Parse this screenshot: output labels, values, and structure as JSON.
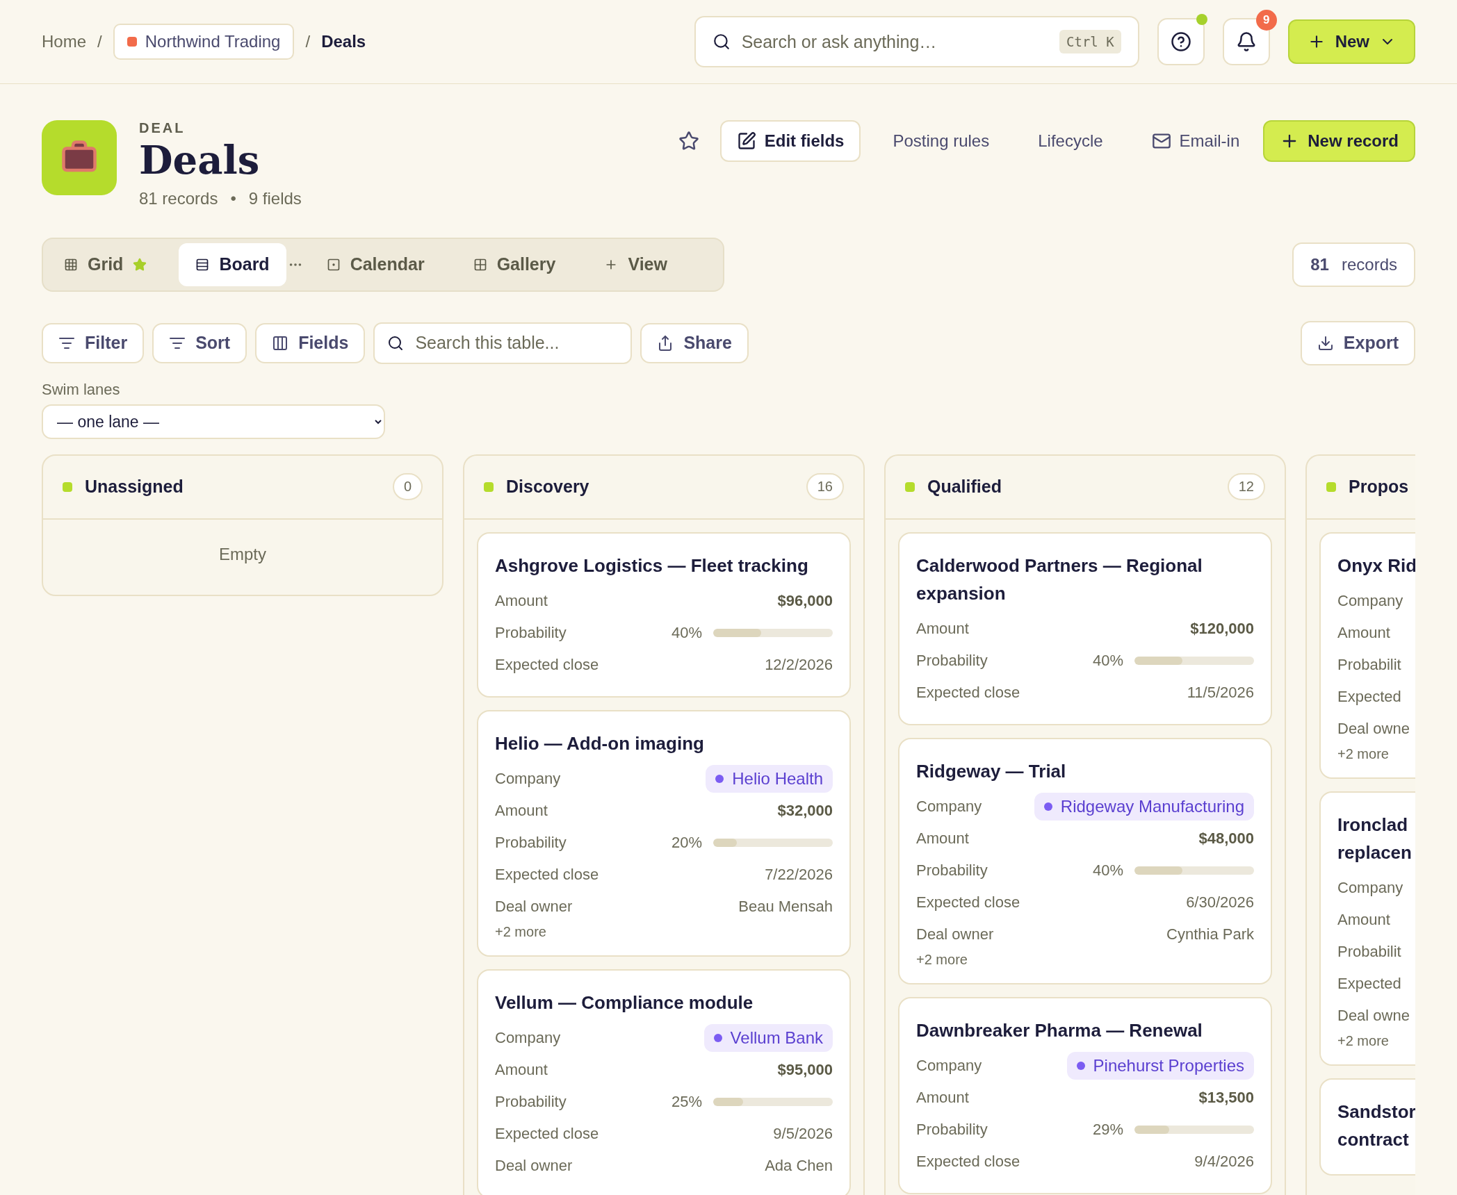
{
  "breadcrumb": {
    "home": "Home",
    "separator": "/",
    "workspace": {
      "label": "Northwind Trading",
      "color": "#f26b4a"
    },
    "separator_2": "/",
    "current": "Deals"
  },
  "search": {
    "placeholder": "Search or ask anything…",
    "shortcut": "Ctrl K"
  },
  "help": {
    "online": true
  },
  "notifications": {
    "count": "9"
  },
  "new_button": {
    "label": "New"
  },
  "header": {
    "eyebrow": "DEAL",
    "title": "Deals",
    "records": "81 records",
    "bullet": "•",
    "fields": "9 fields",
    "starred": false
  },
  "actions": [
    {
      "kind": "outlined",
      "label": "Edit fields"
    },
    {
      "kind": "plain",
      "label": "Posting rules"
    },
    {
      "kind": "plain",
      "label": "Lifecycle"
    },
    {
      "kind": "plain",
      "label": "Email-in"
    },
    {
      "kind": "primary",
      "label": "New record"
    }
  ],
  "views": [
    {
      "label": "Grid",
      "selected": false,
      "favorite": true
    },
    {
      "label": "Board",
      "selected": true,
      "favorite": false,
      "menu": true
    },
    {
      "label": "Calendar",
      "selected": false,
      "favorite": false
    },
    {
      "label": "Gallery",
      "selected": false,
      "favorite": false
    },
    {
      "label": "View",
      "selected": false,
      "favorite": false
    }
  ],
  "record_count": {
    "number": "81",
    "label": "records"
  },
  "toolbar": [
    {
      "label": "Filter"
    },
    {
      "label": "Sort"
    },
    {
      "label": "Fields"
    }
  ],
  "table_search": {
    "placeholder": "Search this table..."
  },
  "share": {
    "label": "Share"
  },
  "export": {
    "label": "Export"
  },
  "swim_lanes": {
    "label": "Swim lanes",
    "value": "— one lane —"
  },
  "columns": [
    {
      "name": "Unassigned",
      "count": "0",
      "empty": "Empty"
    },
    {
      "name": "Discovery",
      "count": "16",
      "cards": [
        {
          "title": "Ashgrove Logistics — Fleet tracking",
          "fields": [
            {
              "kind": "amount",
              "label": "Amount",
              "value": "$96,000"
            },
            {
              "kind": "probability",
              "label": "Probability",
              "value": "40%",
              "level": 0.4
            },
            {
              "kind": "text",
              "label": "Expected close",
              "value": "12/2/2026"
            }
          ]
        },
        {
          "title": "Helio — Add-on imaging",
          "fields": [
            {
              "kind": "company",
              "label": "Company",
              "value": "Helio Health"
            },
            {
              "kind": "amount",
              "label": "Amount",
              "value": "$32,000"
            },
            {
              "kind": "probability",
              "label": "Probability",
              "value": "20%",
              "level": 0.2
            },
            {
              "kind": "text",
              "label": "Expected close",
              "value": "7/22/2026"
            },
            {
              "kind": "text",
              "label": "Deal owner",
              "value": "Beau Mensah"
            }
          ],
          "more": "+2 more"
        },
        {
          "title": "Vellum — Compliance module",
          "fields": [
            {
              "kind": "company",
              "label": "Company",
              "value": "Vellum Bank"
            },
            {
              "kind": "amount",
              "label": "Amount",
              "value": "$95,000"
            },
            {
              "kind": "probability",
              "label": "Probability",
              "value": "25%",
              "level": 0.25
            },
            {
              "kind": "text",
              "label": "Expected close",
              "value": "9/5/2026"
            },
            {
              "kind": "text",
              "label": "Deal owner",
              "value": "Ada Chen"
            }
          ]
        }
      ]
    },
    {
      "name": "Qualified",
      "count": "12",
      "cards": [
        {
          "title": "Calderwood Partners — Regional expansion",
          "fields": [
            {
              "kind": "amount",
              "label": "Amount",
              "value": "$120,000"
            },
            {
              "kind": "probability",
              "label": "Probability",
              "value": "40%",
              "level": 0.4
            },
            {
              "kind": "text",
              "label": "Expected close",
              "value": "11/5/2026"
            }
          ]
        },
        {
          "title": "Ridgeway — Trial",
          "fields": [
            {
              "kind": "company",
              "label": "Company",
              "value": "Ridgeway Manufacturing"
            },
            {
              "kind": "amount",
              "label": "Amount",
              "value": "$48,000"
            },
            {
              "kind": "probability",
              "label": "Probability",
              "value": "40%",
              "level": 0.4
            },
            {
              "kind": "text",
              "label": "Expected close",
              "value": "6/30/2026"
            },
            {
              "kind": "text",
              "label": "Deal owner",
              "value": "Cynthia Park"
            }
          ],
          "more": "+2 more"
        },
        {
          "title": "Dawnbreaker Pharma — Renewal",
          "fields": [
            {
              "kind": "company",
              "label": "Company",
              "value": "Pinehurst Properties"
            },
            {
              "kind": "amount",
              "label": "Amount",
              "value": "$13,500"
            },
            {
              "kind": "probability",
              "label": "Probability",
              "value": "29%",
              "level": 0.29
            },
            {
              "kind": "text",
              "label": "Expected close",
              "value": "9/4/2026"
            }
          ]
        }
      ]
    },
    {
      "name": "Propos",
      "cards": [
        {
          "title": "Onyx Rid",
          "fields": [
            {
              "kind": "label",
              "label": "Company"
            },
            {
              "kind": "label",
              "label": "Amount"
            },
            {
              "kind": "label",
              "label": "Probabilit"
            },
            {
              "kind": "label",
              "label": "Expected"
            },
            {
              "kind": "label",
              "label": "Deal owne"
            }
          ],
          "more": "+2 more"
        },
        {
          "title": "Ironclad replacen",
          "fields": [
            {
              "kind": "label",
              "label": "Company"
            },
            {
              "kind": "label",
              "label": "Amount"
            },
            {
              "kind": "label",
              "label": "Probabilit"
            },
            {
              "kind": "label",
              "label": "Expected"
            },
            {
              "kind": "label",
              "label": "Deal owne"
            }
          ],
          "more": "+2 more"
        },
        {
          "title": "Sandstor contract"
        }
      ]
    }
  ]
}
